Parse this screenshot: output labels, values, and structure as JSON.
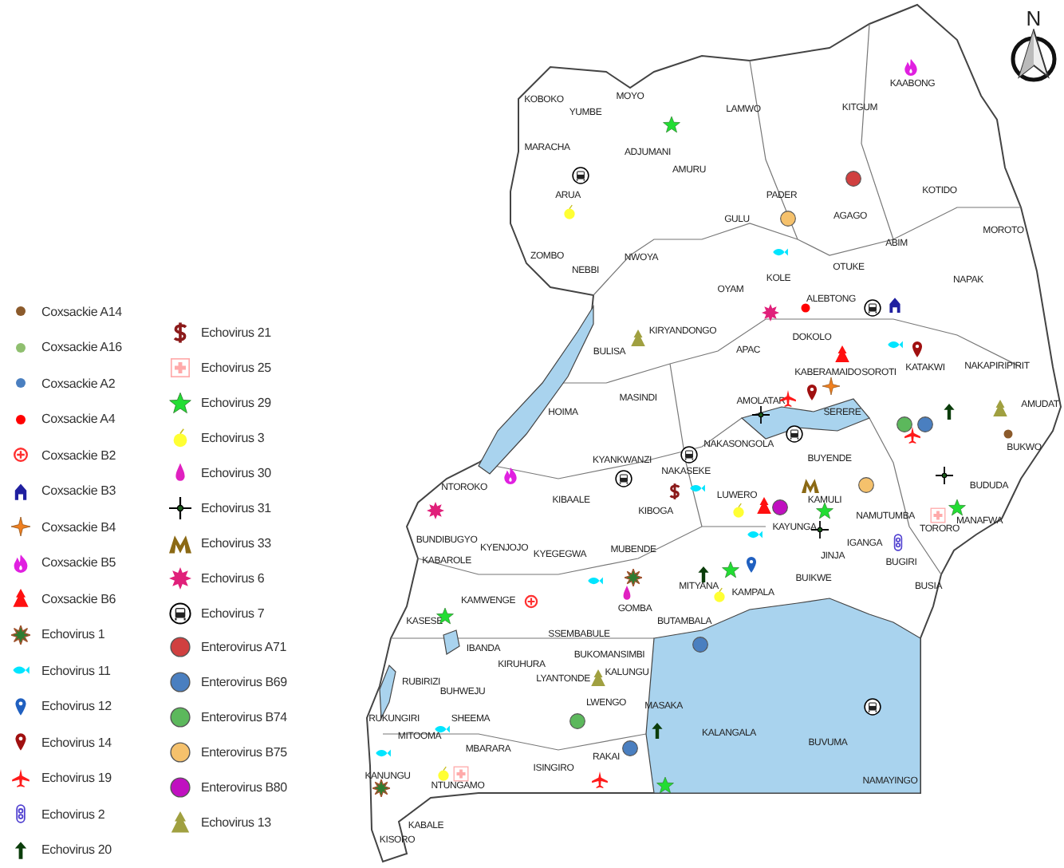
{
  "legend": {
    "columns": [
      [
        {
          "label": "Coxsackie A14",
          "kind": "dot",
          "color": "#8b5a2b"
        },
        {
          "label": "Coxsackie A16",
          "kind": "dot",
          "color": "#8fbf6f"
        },
        {
          "label": "Coxsackie A2",
          "kind": "dot",
          "color": "#4a7fc0"
        },
        {
          "label": "Coxsackie A4",
          "kind": "dot",
          "color": "#ff0000"
        },
        {
          "label": "Coxsackie B2",
          "kind": "target",
          "color": "#ff3030"
        },
        {
          "label": "Coxsackie B3",
          "kind": "house",
          "color": "#2020a0"
        },
        {
          "label": "Coxsackie B4",
          "kind": "sparkle",
          "color": "#f08020"
        },
        {
          "label": "Coxsackie B5",
          "kind": "fire",
          "color": "#e020e0"
        },
        {
          "label": "Coxsackie B6",
          "kind": "tree",
          "color": "#ff1010"
        },
        {
          "label": "Echovirus 1",
          "kind": "burst",
          "color": "#2e7d32"
        },
        {
          "label": "Echovirus 11",
          "kind": "fish",
          "color": "#00e5ff"
        },
        {
          "label": "Echovirus 12",
          "kind": "pin",
          "color": "#2060c0"
        },
        {
          "label": "Echovirus 14",
          "kind": "pin",
          "color": "#a01010"
        },
        {
          "label": "Echovirus 19",
          "kind": "plane",
          "color": "#ff1a1a"
        },
        {
          "label": "Echovirus 2",
          "kind": "capsule",
          "color": "#5040d0"
        },
        {
          "label": "Echovirus 20",
          "kind": "arrow",
          "color": "#0b3d0b"
        }
      ],
      [
        {
          "label": "Echovirus 21",
          "kind": "dollar",
          "color": "#8b1a1a"
        },
        {
          "label": "Echovirus 25",
          "kind": "hospital",
          "color": "#ffaaaa"
        },
        {
          "label": "Echovirus 29",
          "kind": "star",
          "color": "#22dd33"
        },
        {
          "label": "Echovirus 3",
          "kind": "apple",
          "color": "#ffff33"
        },
        {
          "label": "Echovirus 30",
          "kind": "drop",
          "color": "#e020c0"
        },
        {
          "label": "Echovirus 31",
          "kind": "cross",
          "color": "#000000"
        },
        {
          "label": "Echovirus 33",
          "kind": "moth",
          "color": "#8b6914"
        },
        {
          "label": "Echovirus 6",
          "kind": "flower",
          "color": "#e0207a"
        },
        {
          "label": "Echovirus 7",
          "kind": "bus",
          "color": "#000000"
        },
        {
          "label": "Enterovirus  A71",
          "kind": "circle",
          "color": "#d04040"
        },
        {
          "label": "Enterovirus  B69",
          "kind": "circle",
          "color": "#4a7fc0"
        },
        {
          "label": "Enterovirus  B74",
          "kind": "circle",
          "color": "#5cb85c"
        },
        {
          "label": "Enterovirus  B75",
          "kind": "circle",
          "color": "#f5c16c"
        },
        {
          "label": "Enterovirus  B80",
          "kind": "circle",
          "color": "#c010c0"
        },
        {
          "label": "Echovirus 13",
          "kind": "tree",
          "color": "#a0a040"
        }
      ]
    ]
  },
  "map": {
    "compass_label": "N",
    "districts": [
      "KOBOKO",
      "YUMBE",
      "MOYO",
      "MARACHA",
      "ADJUMANI",
      "AMURU",
      "ARUA",
      "ZOMBO",
      "NEBBI",
      "NWOYA",
      "KIRYANDONGO",
      "BULISA",
      "MASINDI",
      "HOIMA",
      "KAABONG",
      "LAMWO",
      "KITGUM",
      "PADER",
      "AGAGO",
      "KOTIDO",
      "GULU",
      "MOROTO",
      "ABIM",
      "OTUKE",
      "OYAM",
      "KOLE",
      "NAPAK",
      "ALEBTONG",
      "DOKOLO",
      "APAC",
      "KABERAMAIDO",
      "SOROTI",
      "KATAKWI",
      "NAKAPIRIPIRIT",
      "AMUDAT",
      "AMOLATAR",
      "SERERE",
      "NTOROKO",
      "KYANKWANZI",
      "NAKASEKE",
      "KIBAALE",
      "KIBOGA",
      "BUNDIBUGYO",
      "KYENJOJO",
      "KYEGEGWA",
      "MUBENDE",
      "KABAROLE",
      "KAMWENGE",
      "GOMBA",
      "MITYANA",
      "KASESE",
      "BUTAMBALA",
      "SSEMBABULE",
      "IBANDA",
      "BUKOMANSIMBI",
      "KIRUHURA",
      "LYANTONDE",
      "KALUNGU",
      "RUBIRIZI",
      "BUHWEJU",
      "LWENGO",
      "MASAKA",
      "RUKUNGIRI",
      "SHEEMA",
      "MITOOMA",
      "MBARARA",
      "ISINGIRO",
      "RAKAI",
      "KANUNGU",
      "NTUNGAMO",
      "KABALE",
      "KISORO",
      "NAKASONGOLA",
      "BUYENDE",
      "LUWERO",
      "KAMULI",
      "KAYUNGA",
      "NAMUTUMBA",
      "TORORO",
      "BUDUDA",
      "MANAFWA",
      "JINJA",
      "IGANGA",
      "BUGIRI",
      "BUSIA",
      "BUIKWE",
      "KAMPALA",
      "BUVUMA",
      "KALANGALA",
      "NAMAYINGO",
      "BUKWO"
    ],
    "markers": [
      {
        "kind": "star",
        "color": "#22dd33"
      },
      {
        "kind": "bus",
        "color": "#000000"
      },
      {
        "kind": "apple",
        "color": "#ffff33"
      },
      {
        "kind": "tree",
        "color": "#a0a040"
      },
      {
        "kind": "circle",
        "color": "#d04040"
      },
      {
        "kind": "circle",
        "color": "#f5c16c"
      },
      {
        "kind": "fish",
        "color": "#00e5ff"
      },
      {
        "kind": "flower",
        "color": "#e0207a"
      },
      {
        "kind": "dot",
        "color": "#ff0000"
      },
      {
        "kind": "bus",
        "color": "#000000"
      },
      {
        "kind": "house",
        "color": "#2020a0"
      },
      {
        "kind": "fish",
        "color": "#00e5ff"
      },
      {
        "kind": "pin",
        "color": "#a01010"
      },
      {
        "kind": "tree",
        "color": "#ff1010"
      },
      {
        "kind": "plane",
        "color": "#ff1a1a"
      },
      {
        "kind": "pin",
        "color": "#a01010"
      },
      {
        "kind": "sparkle",
        "color": "#f08020"
      },
      {
        "kind": "cross",
        "color": "#000000"
      },
      {
        "kind": "fire",
        "color": "#e020e0"
      },
      {
        "kind": "fire",
        "color": "#e020e0"
      },
      {
        "kind": "flower",
        "color": "#e0207a"
      },
      {
        "kind": "bus",
        "color": "#000000"
      },
      {
        "kind": "bus",
        "color": "#000000"
      },
      {
        "kind": "dollar",
        "color": "#8b1a1a"
      },
      {
        "kind": "fish",
        "color": "#00e5ff"
      },
      {
        "kind": "burst",
        "color": "#2e7d32"
      },
      {
        "kind": "fish",
        "color": "#00e5ff"
      },
      {
        "kind": "drop",
        "color": "#e020c0"
      },
      {
        "kind": "arrow",
        "color": "#0b3d0b"
      },
      {
        "kind": "target",
        "color": "#ff3030"
      },
      {
        "kind": "star",
        "color": "#22dd33"
      },
      {
        "kind": "tree",
        "color": "#a0a040"
      },
      {
        "kind": "circle",
        "color": "#5cb85c"
      },
      {
        "kind": "circle",
        "color": "#4a7fc0"
      },
      {
        "kind": "plane",
        "color": "#ff1a1a"
      },
      {
        "kind": "star",
        "color": "#22dd33"
      },
      {
        "kind": "arrow",
        "color": "#0b3d0b"
      },
      {
        "kind": "fish",
        "color": "#00e5ff"
      },
      {
        "kind": "fish",
        "color": "#00e5ff"
      },
      {
        "kind": "apple",
        "color": "#ffff33"
      },
      {
        "kind": "hospital",
        "color": "#ffaaaa"
      },
      {
        "kind": "burst",
        "color": "#2e7d32"
      },
      {
        "kind": "circle",
        "color": "#4a7fc0"
      },
      {
        "kind": "circle",
        "color": "#c010c0"
      },
      {
        "kind": "tree",
        "color": "#ff1010"
      },
      {
        "kind": "apple",
        "color": "#ffff33"
      },
      {
        "kind": "fish",
        "color": "#00e5ff"
      },
      {
        "kind": "star",
        "color": "#22dd33"
      },
      {
        "kind": "pin",
        "color": "#2060c0"
      },
      {
        "kind": "apple",
        "color": "#ffff33"
      },
      {
        "kind": "star",
        "color": "#22dd33"
      },
      {
        "kind": "cross",
        "color": "#000000"
      },
      {
        "kind": "moth",
        "color": "#8b6914"
      },
      {
        "kind": "plane",
        "color": "#ff1a1a"
      },
      {
        "kind": "circle",
        "color": "#5cb85c"
      },
      {
        "kind": "circle",
        "color": "#4a7fc0"
      },
      {
        "kind": "bus",
        "color": "#000000"
      },
      {
        "kind": "bus",
        "color": "#000000"
      },
      {
        "kind": "capsule",
        "color": "#5040d0"
      },
      {
        "kind": "star",
        "color": "#22dd33"
      },
      {
        "kind": "cross",
        "color": "#000000"
      },
      {
        "kind": "hospital",
        "color": "#ffaaaa"
      },
      {
        "kind": "circle",
        "color": "#f5c16c"
      },
      {
        "kind": "tree",
        "color": "#a0a040"
      },
      {
        "kind": "arrow",
        "color": "#0b3d0b"
      },
      {
        "kind": "dot",
        "color": "#8b5a2b"
      }
    ]
  }
}
